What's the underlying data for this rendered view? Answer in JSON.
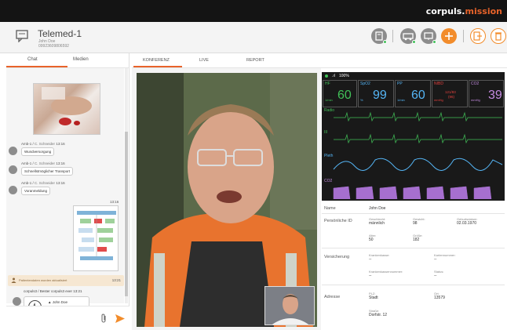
{
  "brand": {
    "name": "corpuls.",
    "accent": "mission",
    "accent_color": "#e8632a"
  },
  "header": {
    "title": "Telemed-1",
    "subtitle1": "John Doe",
    "subtitle2": "09923609806592"
  },
  "left_tabs": {
    "chat": "Chat",
    "media": "Medien"
  },
  "chat": {
    "messages": [
      {
        "sender": "Amb-1",
        "name": "C. Schneider",
        "time": "13:16",
        "text": "Wundversorgung"
      },
      {
        "sender": "Amb-1",
        "name": "C. Schneider",
        "time": "13:16",
        "text": "Schnellstmöglicher Transport"
      },
      {
        "sender": "Amb-1",
        "name": "C. Schneider",
        "time": "13:16",
        "text": "Voranmeldung"
      }
    ],
    "doc_time": "13:16",
    "notification": {
      "text": "Patientendaten wurden aktualisiert",
      "time": "13:21"
    },
    "ecg_meta": "corpuls3 / Bester corpuls3 ever 13:21",
    "ecg_card": {
      "name": "John Doe",
      "time": "13:17"
    }
  },
  "mid_tabs": {
    "konferenz": "KONFERENZ",
    "live": "LIVE",
    "report": "REPORT"
  },
  "monitor": {
    "status": "100%",
    "hf": {
      "label": "HF",
      "unit": "1/min",
      "value": "60"
    },
    "spo2": {
      "label": "SpO2",
      "unit": "%",
      "value": "99"
    },
    "pp": {
      "label": "PP",
      "unit": "1/min",
      "value": "60"
    },
    "nibd": {
      "label": "NIBD",
      "unit": "mmHg",
      "value": "121/83",
      "sub": "(96)"
    },
    "co2": {
      "label": "CO2",
      "unit": "mmHg",
      "value": "39"
    },
    "lead1": "Radio",
    "lead2": "III",
    "pleth": "Pleth",
    "co2_wave": "CO2"
  },
  "patient": {
    "name_label": "Name",
    "name_value": "John Doe",
    "pid_label": "Persönliche ID",
    "gender_label": "Geschlecht:",
    "gender_value": "männlich",
    "weight_label": "Gewicht:",
    "weight_value": "98",
    "dob_label": "Geburtsdatum:",
    "dob_value": "02.03.1970",
    "age_label": "Alter:",
    "age_value": "50",
    "height_label": "Größe:",
    "height_value": "182",
    "ins_label": "Versicherung",
    "kk_label": "Krankenkasse:",
    "kk_value": "--",
    "card_label": "Kartennummer:",
    "card_value": "--",
    "kkn_label": "Krankenkassennummer:",
    "kkn_value": "--",
    "status_label": "Status:",
    "status_value": "--",
    "addr_label": "Adresse",
    "plz_label": "PLZ:",
    "plz_value": "Stadt",
    "ort_label": "Ort:",
    "ort_value": "13579",
    "street_label": "Straße:",
    "street_value": "Dorfstr. 12"
  }
}
